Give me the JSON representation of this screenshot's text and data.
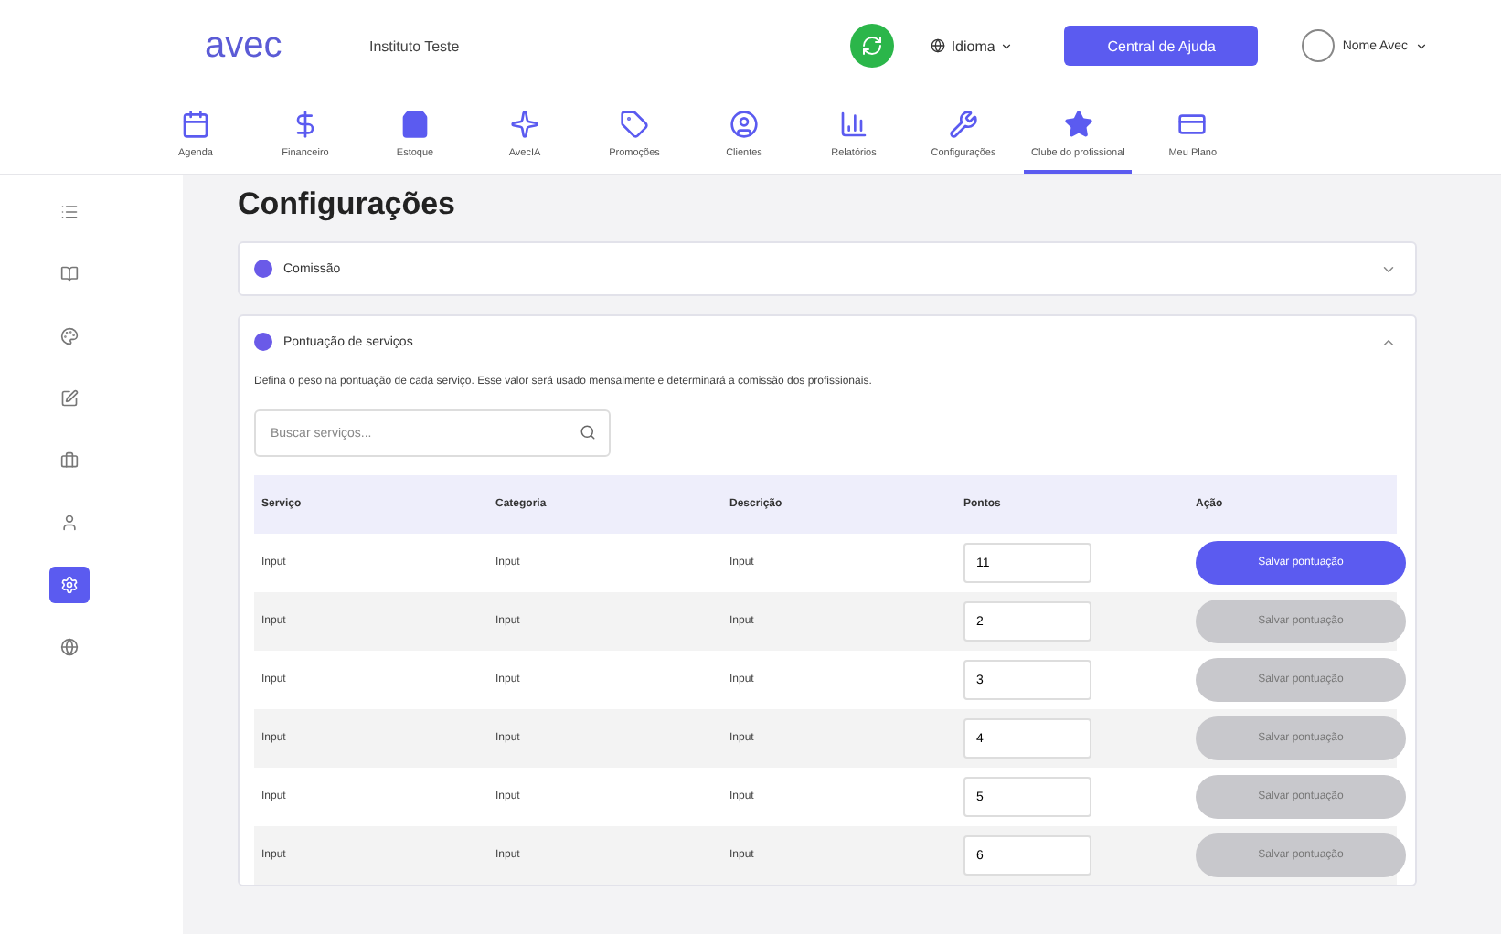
{
  "header": {
    "brand": "avec",
    "salon": "Instituto Teste",
    "language": "Idioma",
    "help_button": "Central de Ajuda",
    "user": "Nome Avec"
  },
  "nav": [
    {
      "label": "Agenda",
      "selected": false
    },
    {
      "label": "Financeiro",
      "selected": false
    },
    {
      "label": "Estoque",
      "selected": false
    },
    {
      "label": "AvecIA",
      "selected": false
    },
    {
      "label": "Promoções",
      "selected": false
    },
    {
      "label": "Clientes",
      "selected": false
    },
    {
      "label": "Relatórios",
      "selected": false
    },
    {
      "label": "Configurações",
      "selected": false
    },
    {
      "label": "Clube do profissional",
      "selected": true
    },
    {
      "label": "Meu Plano",
      "selected": false
    }
  ],
  "sidebar": [
    {
      "selected": false
    },
    {
      "selected": false
    },
    {
      "selected": false
    },
    {
      "selected": false
    },
    {
      "selected": false
    },
    {
      "selected": false
    },
    {
      "selected": true
    },
    {
      "selected": false
    }
  ],
  "page_title": "Configurações",
  "sections": [
    {
      "title": "Comissão",
      "expanded": false
    },
    {
      "title": "Pontuação de serviços",
      "expanded": true,
      "description": "Defina o peso na pontuação de cada serviço. Esse valor será usado mensalmente e determinará a comissão dos profissionais.",
      "search": {
        "placeholder": "Buscar serviços..."
      },
      "table": {
        "columns": [
          "Serviço",
          "Categoria",
          "Descrição",
          "Pontos",
          "Ação"
        ],
        "rows": [
          {
            "cells": [
              "Input",
              "Input",
              "Input"
            ],
            "points": "11",
            "button": "Salvar pontuação",
            "disabled": false
          },
          {
            "cells": [
              "Input",
              "Input",
              "Input"
            ],
            "points": "2",
            "button": "Salvar pontuação",
            "disabled": true
          },
          {
            "cells": [
              "Input",
              "Input",
              "Input"
            ],
            "points": "3",
            "button": "Salvar pontuação",
            "disabled": true
          },
          {
            "cells": [
              "Input",
              "Input",
              "Input"
            ],
            "points": "4",
            "button": "Salvar pontuação",
            "disabled": true
          },
          {
            "cells": [
              "Input",
              "Input",
              "Input"
            ],
            "points": "5",
            "button": "Salvar pontuação",
            "disabled": true
          },
          {
            "cells": [
              "Input",
              "Input",
              "Input"
            ],
            "points": "6",
            "button": "Salvar pontuação",
            "disabled": true
          }
        ]
      }
    }
  ]
}
